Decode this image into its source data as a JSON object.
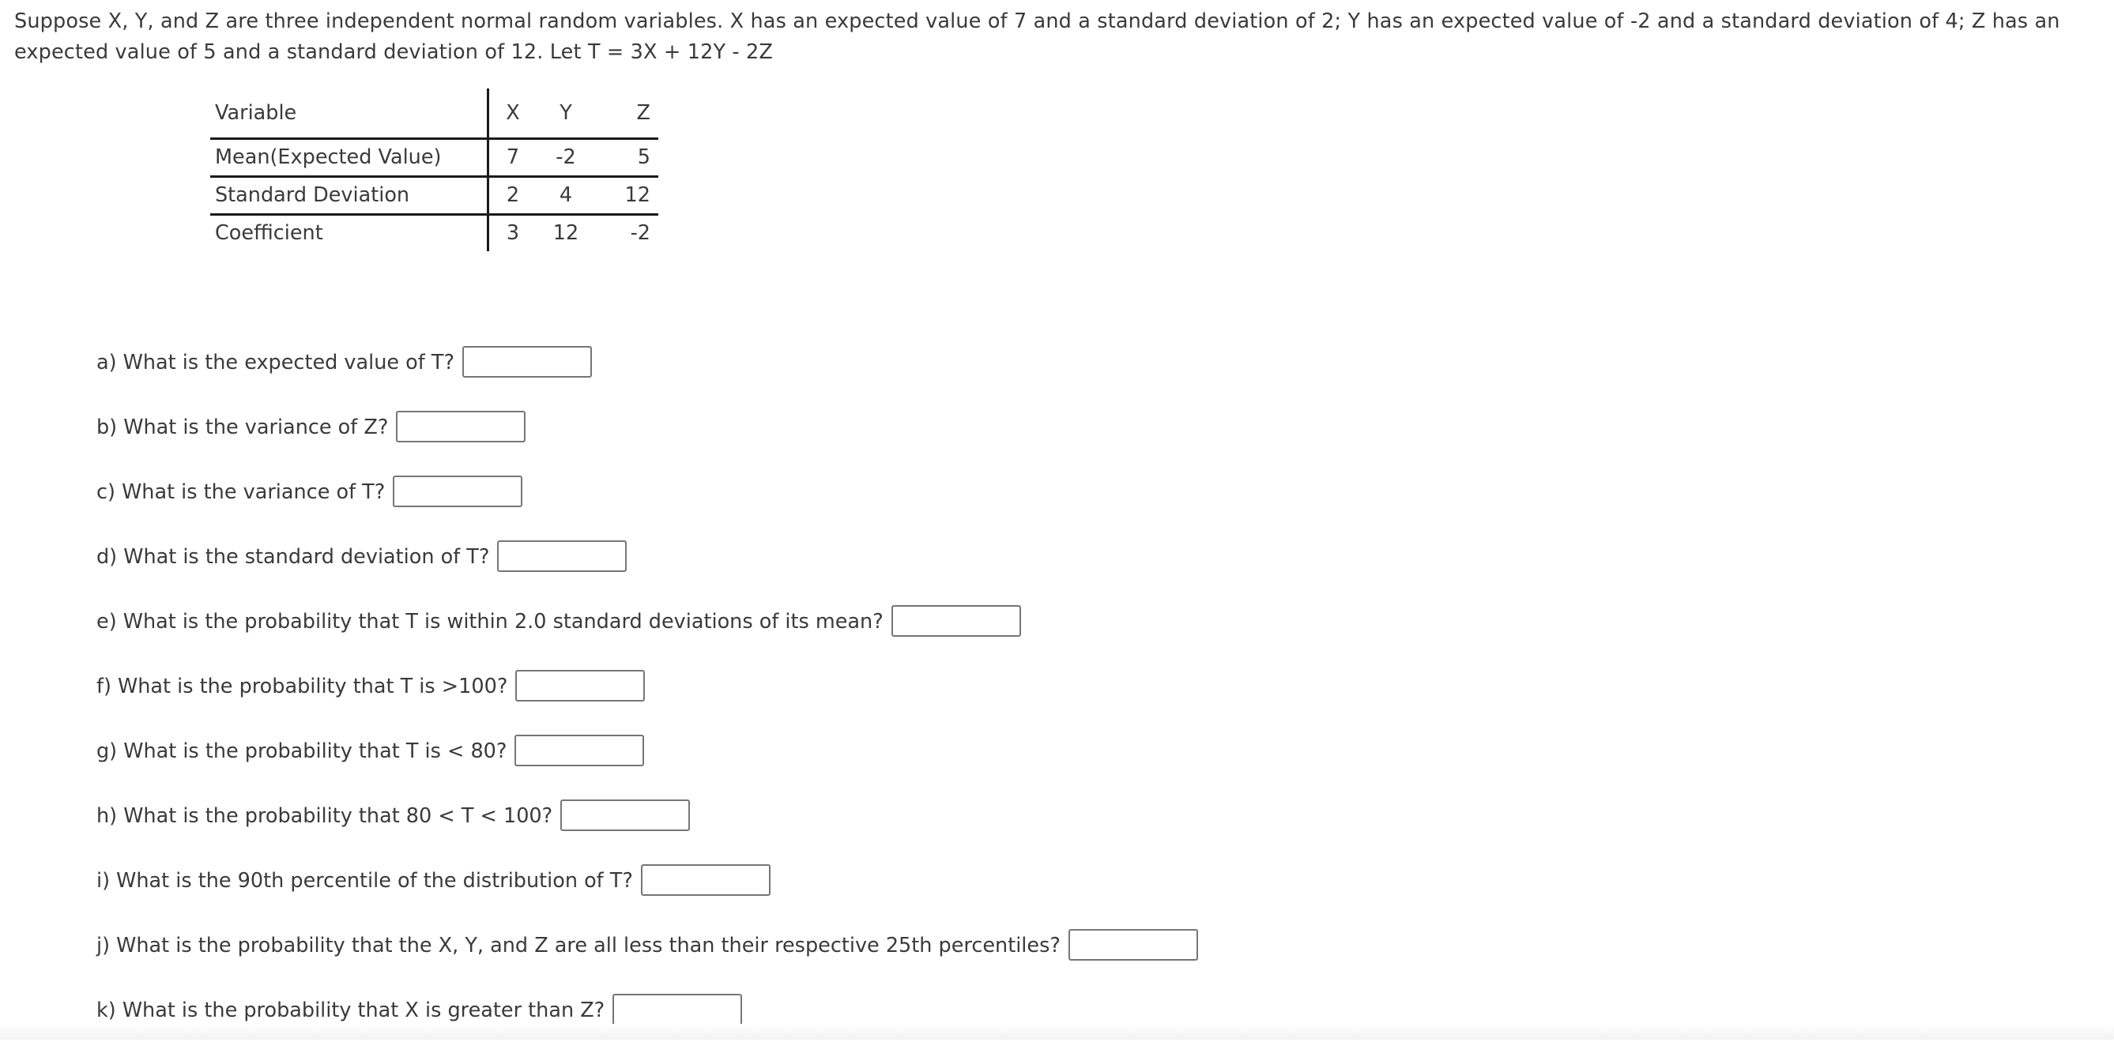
{
  "intro": {
    "text": "Suppose X, Y, and Z are three independent normal random variables. X has an expected value of 7 and a standard deviation of 2; Y has an expected value of -2 and a standard deviation of 4; Z has an expected value of 5 and a standard deviation of 12. Let T = 3X + 12Y - 2Z"
  },
  "table": {
    "header": {
      "label": "Variable",
      "x": "X",
      "y": "Y",
      "z": "Z"
    },
    "rows": [
      {
        "label": "Mean(Expected Value)",
        "x": "7",
        "y": "-2",
        "z": "5"
      },
      {
        "label": "Standard Deviation",
        "x": "2",
        "y": "4",
        "z": "12"
      },
      {
        "label": "Coefficient",
        "x": "3",
        "y": "12",
        "z": "-2"
      }
    ]
  },
  "questions": [
    {
      "text": "a) What is the expected value of T?",
      "value": ""
    },
    {
      "text": "b) What is the variance of Z?",
      "value": ""
    },
    {
      "text": "c) What is the variance of T?",
      "value": ""
    },
    {
      "text": "d) What is the standard deviation of T?",
      "value": ""
    },
    {
      "text": "e) What is the probability that T is within 2.0 standard deviations of its mean?",
      "value": ""
    },
    {
      "text": "f) What is the probability that T is >100?",
      "value": ""
    },
    {
      "text": "g) What is the probability that T is < 80?",
      "value": ""
    },
    {
      "text": "h) What is the probability that 80 < T < 100?",
      "value": ""
    },
    {
      "text": "i) What is the 90th percentile of the distribution of T?",
      "value": ""
    },
    {
      "text": "j) What is the probability that the X, Y, and Z are all less than their respective 25th percentiles?",
      "value": ""
    },
    {
      "text": "k) What is the probability that X is greater than Z?",
      "value": ""
    }
  ]
}
